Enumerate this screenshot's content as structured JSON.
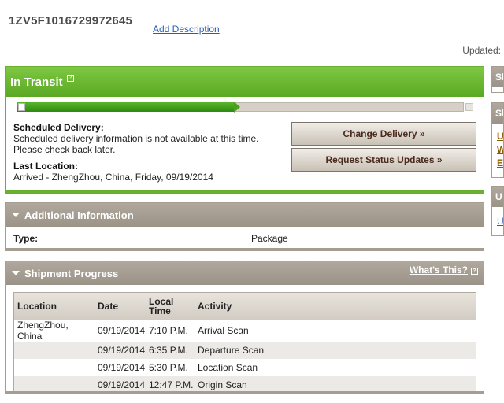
{
  "tracking_number": "1ZV5F1016729972645",
  "add_description": "Add Description",
  "updated_label": "Updated:",
  "status": {
    "title": "In Transit",
    "help_glyph": "?",
    "progress_fraction": 0.5,
    "scheduled_label": "Scheduled Delivery:",
    "scheduled_text": "Scheduled delivery information is not available at this time. Please check back later.",
    "last_location_label": "Last Location:",
    "last_location_text": "Arrived - ZhengZhou, China, Friday, 09/19/2014",
    "change_delivery_label": "Change Delivery »",
    "request_updates_label": "Request Status Updates »"
  },
  "additional_info": {
    "title": "Additional Information",
    "type_label": "Type:",
    "type_value": "Package"
  },
  "shipment_progress": {
    "title": "Shipment Progress",
    "whats_this": "What's This?",
    "help_glyph": "?",
    "columns": [
      "Location",
      "Date",
      "Local Time",
      "Activity"
    ],
    "rows": [
      {
        "location": "ZhengZhou, China",
        "date": "09/19/2014",
        "time": "7:10 P.M.",
        "activity": "Arrival Scan"
      },
      {
        "location": "",
        "date": "09/19/2014",
        "time": "6:35 P.M.",
        "activity": "Departure Scan"
      },
      {
        "location": "",
        "date": "09/19/2014",
        "time": "5:30 P.M.",
        "activity": "Location Scan"
      },
      {
        "location": "",
        "date": "09/19/2014",
        "time": "12:47 P.M.",
        "activity": "Origin Scan"
      }
    ]
  },
  "side": {
    "panel1_head": "Sh",
    "panel2_head": "Sh",
    "panel2_links": [
      "U",
      "W",
      "E"
    ],
    "panel3_head": "U",
    "panel3_link": "U"
  },
  "colors": {
    "status_green": "#5aa823",
    "section_grey": "#a59d92",
    "button_text": "#4c2a1e",
    "link_blue": "#2a5db0"
  }
}
